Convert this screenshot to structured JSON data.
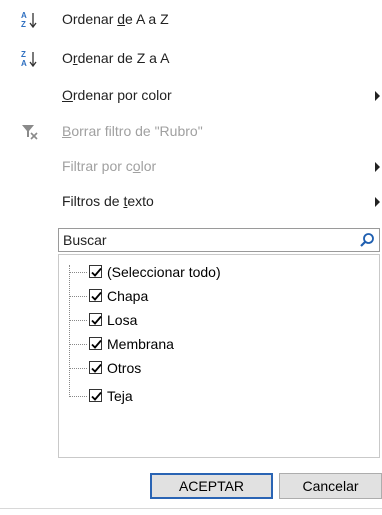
{
  "menu": {
    "sort_az": {
      "pre": "Ordenar ",
      "acc": "d",
      "post": "e A a Z"
    },
    "sort_za": {
      "pre": "O",
      "acc": "r",
      "post": "denar de Z a A"
    },
    "sort_color": {
      "pre": "",
      "acc": "O",
      "post": "rdenar por color"
    },
    "clear_filter": {
      "pre": "",
      "acc": "B",
      "post": "orrar filtro de \"Rubro\""
    },
    "filter_color": {
      "pre": "Filtrar por c",
      "acc": "o",
      "post": "lor"
    },
    "text_filters": {
      "pre": "Filtros de ",
      "acc": "t",
      "post": "exto"
    }
  },
  "icons": {
    "sort_az": "sort-ascending-icon",
    "sort_za": "sort-descending-icon",
    "clear_filter": "clear-filter-icon",
    "search": "search-icon",
    "submenu": "chevron-right-icon"
  },
  "search": {
    "placeholder": "Buscar"
  },
  "list": {
    "items": [
      {
        "label": "(Seleccionar todo)",
        "checked": true
      },
      {
        "label": "Chapa",
        "checked": true
      },
      {
        "label": "Losa",
        "checked": true
      },
      {
        "label": "Membrana",
        "checked": true
      },
      {
        "label": "Otros",
        "checked": true
      },
      {
        "label": "Teja",
        "checked": true
      }
    ]
  },
  "buttons": {
    "ok": "ACEPTAR",
    "cancel": "Cancelar"
  },
  "colors": {
    "accent": "#2a64b4",
    "disabled_text": "#a0a0a0",
    "sort_blue": "#2e6fc0",
    "clear_red": "#d04040"
  }
}
